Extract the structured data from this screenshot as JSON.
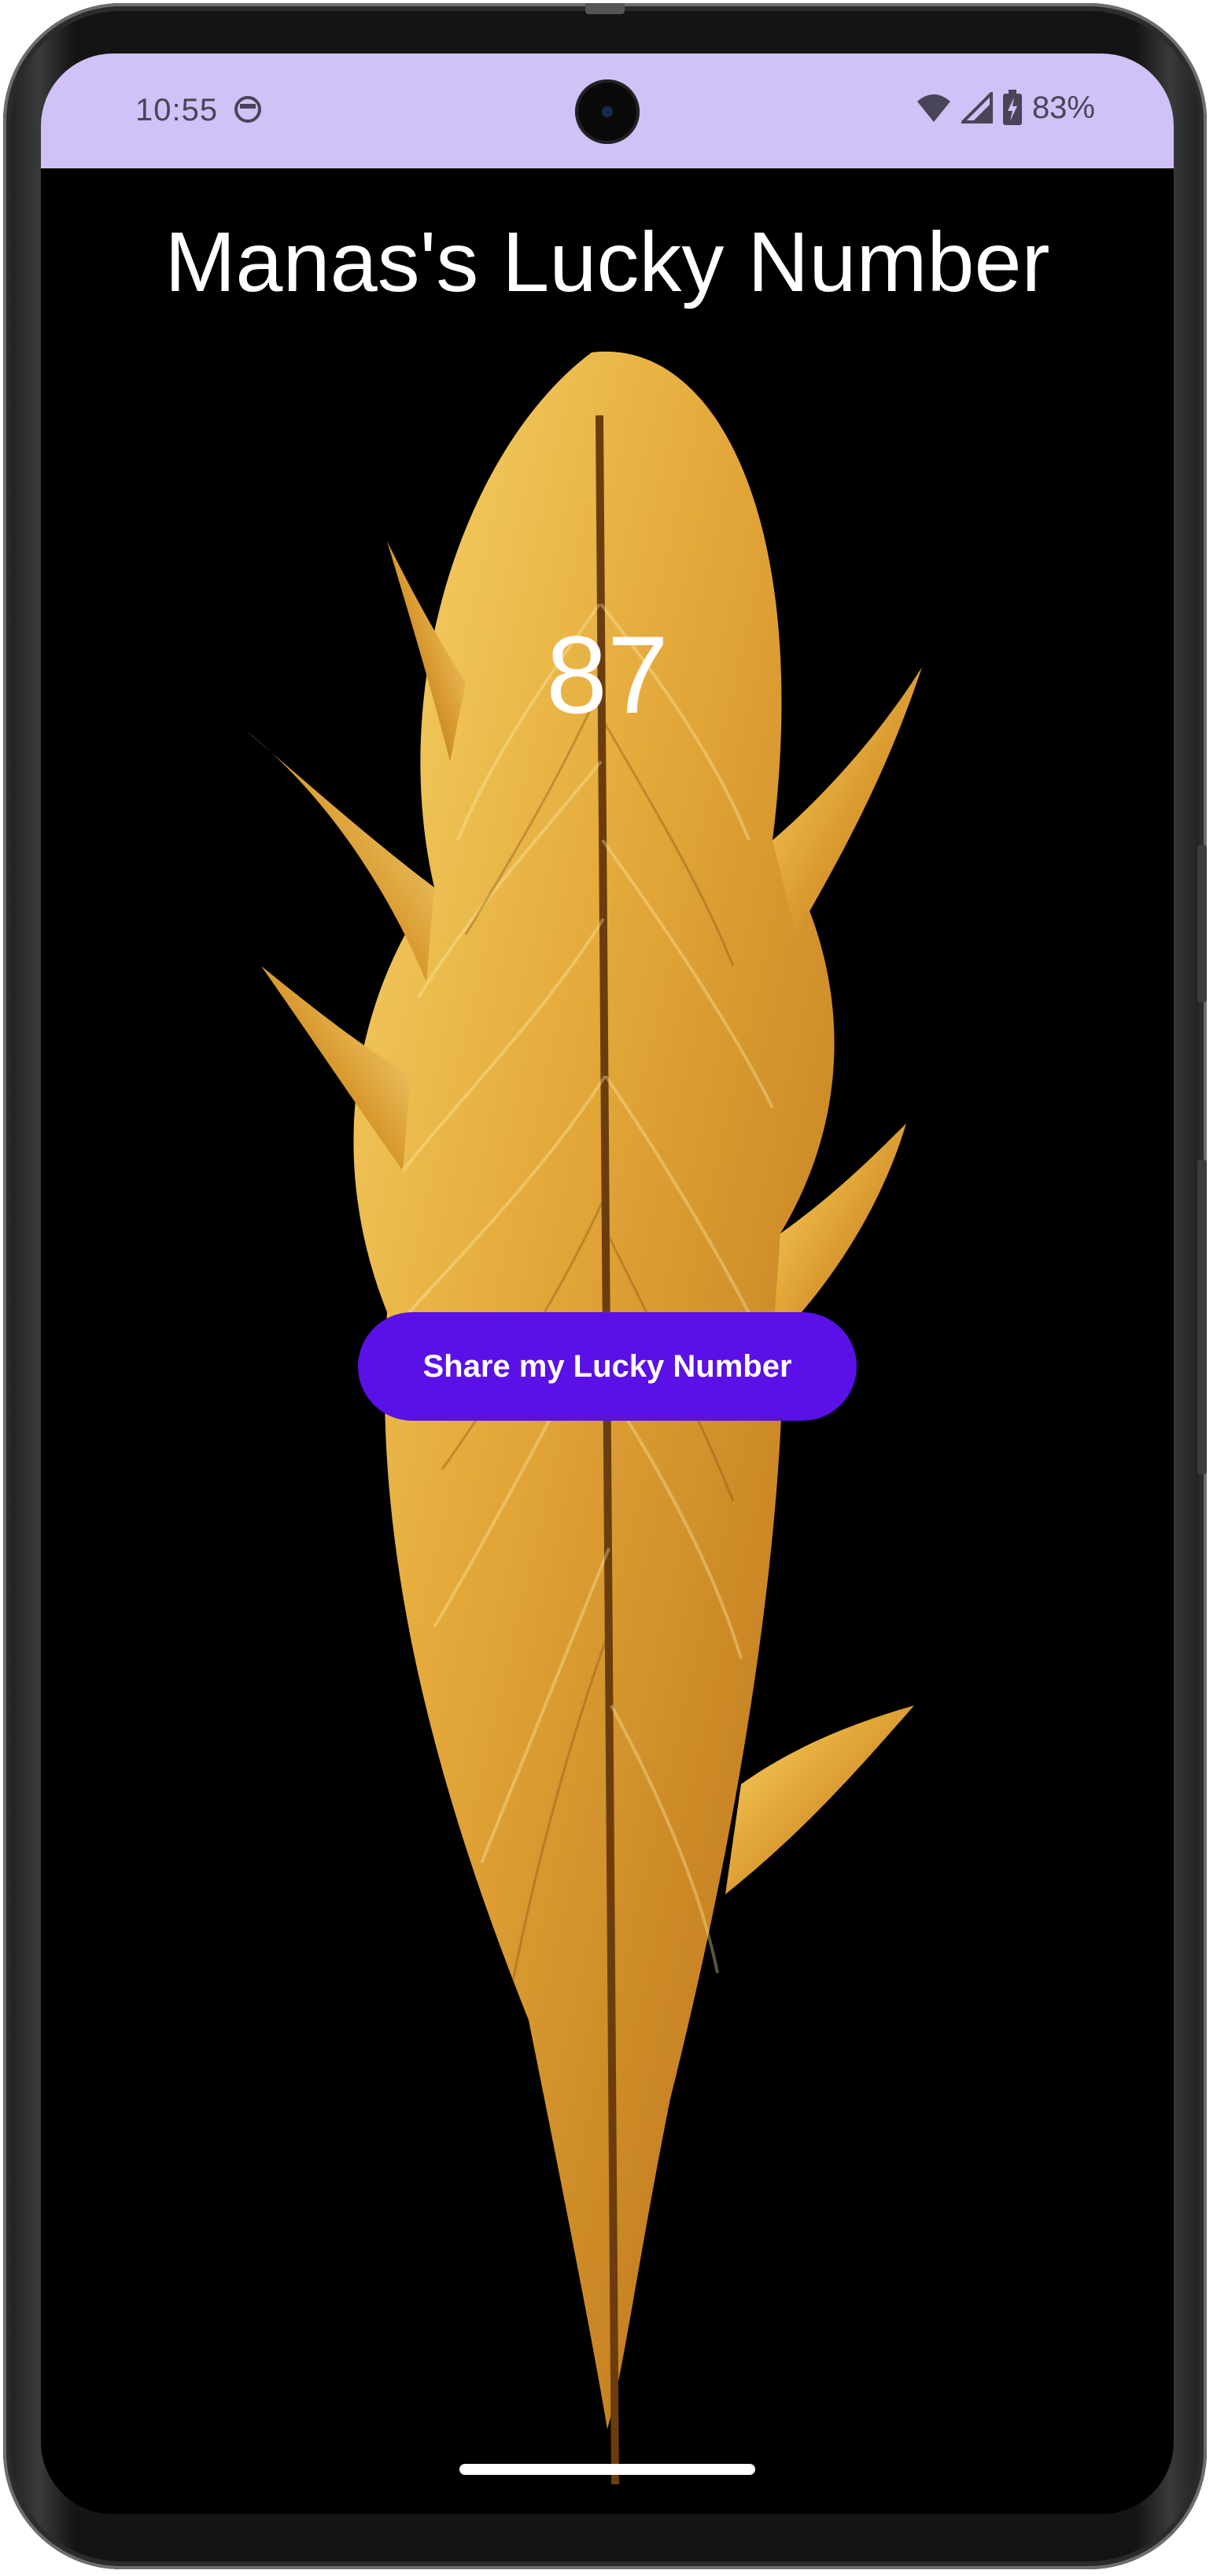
{
  "status_bar": {
    "time": "10:55",
    "battery": "83%",
    "background_color": "#d0c1f7"
  },
  "app": {
    "title": "Manas's Lucky Number",
    "lucky_number": "87",
    "share_button_label": "Share my Lucky Number",
    "button_color": "#5a10e6",
    "background_color": "#000000"
  },
  "icons": {
    "status_app": "app-notification-icon",
    "wifi": "wifi-icon",
    "signal": "signal-icon",
    "battery": "battery-charging-icon",
    "background_art": "feather-image"
  }
}
